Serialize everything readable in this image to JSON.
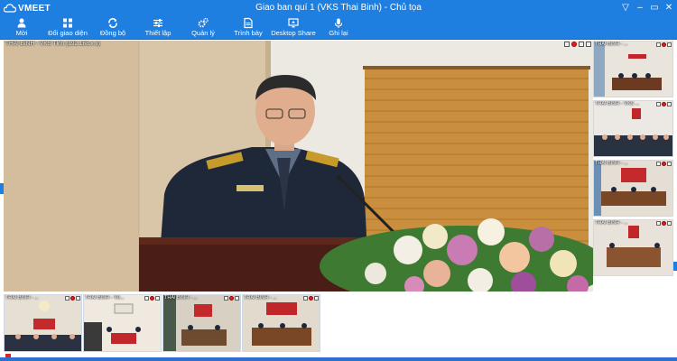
{
  "app": {
    "brand": "VMEET",
    "window_title": "Giao ban quí 1 (VKS Thai Binh) - Chủ tọa",
    "window_controls": [
      "▽",
      "–",
      "▭",
      "✕"
    ]
  },
  "toolbar": {
    "items": [
      {
        "label": "Mời",
        "icon": "user-add-icon"
      },
      {
        "label": "Đổi giao diện",
        "icon": "layout-grid-icon"
      },
      {
        "label": "Đồng bộ",
        "icon": "sync-icon"
      },
      {
        "label": "Thiết lập",
        "icon": "sliders-icon"
      },
      {
        "label": "Quản lý",
        "icon": "gears-icon"
      },
      {
        "label": "Trình bày",
        "icon": "document-present-icon"
      },
      {
        "label": "Desktop Share",
        "icon": "monitor-share-icon"
      },
      {
        "label": "Ghi lại",
        "icon": "microphone-icon"
      }
    ]
  },
  "main_video": {
    "label": "THÁI BÌNH - VKS Tỉnh (192.168.x.x)",
    "scene": "speaker-at-podium"
  },
  "side_videos": [
    {
      "label": "THÁI BÌNH - ...",
      "scene": "meeting-room"
    },
    {
      "label": "THÁI BÌNH - VKS ...",
      "scene": "meeting-room"
    },
    {
      "label": "THÁI BÌNH - ...",
      "scene": "meeting-room"
    },
    {
      "label": "THÁI BÌNH - ...",
      "scene": "meeting-room"
    }
  ],
  "bottom_videos": [
    {
      "label": "THÁI BÌNH - ...",
      "scene": "meeting-room"
    },
    {
      "label": "THÁI BÌNH - Vũ...",
      "scene": "meeting-room"
    },
    {
      "label": "THÁI BÌNH - ...",
      "scene": "meeting-room"
    },
    {
      "label": "THÁI BÌNH - ...",
      "scene": "meeting-room"
    }
  ],
  "colors": {
    "accent": "#1f7fe0",
    "room_banner": "#c0262a",
    "uniform": "#1e2838"
  }
}
